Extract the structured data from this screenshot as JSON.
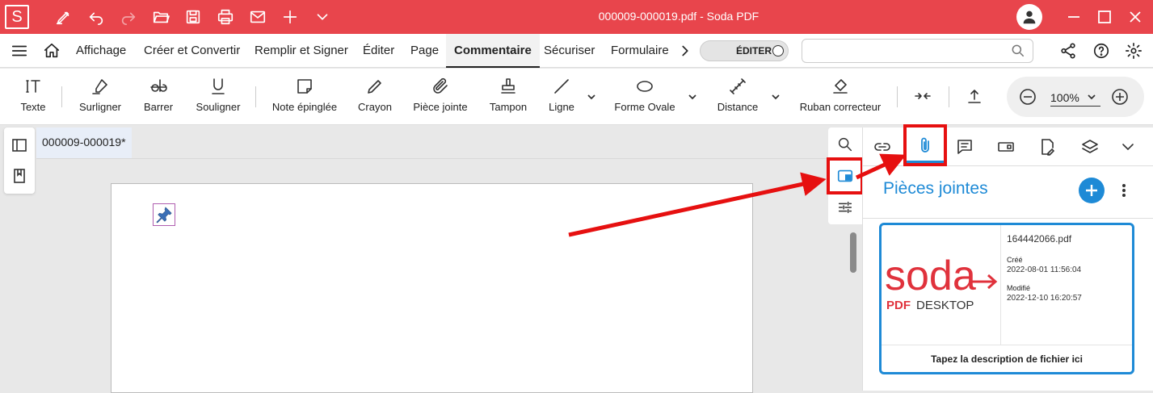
{
  "app": {
    "logo_letter": "S",
    "title": "000009-000019.pdf  -  Soda PDF"
  },
  "menu": {
    "items": [
      "Affichage",
      "Créer et Convertir",
      "Remplir et Signer",
      "Éditer",
      "Page",
      "Commentaire",
      "Sécuriser",
      "Formulaire"
    ],
    "active": "Commentaire",
    "edit_toggle_label": "ÉDITER",
    "search_placeholder": ""
  },
  "toolbar": {
    "tools": [
      {
        "label": "Texte",
        "icon": "text-icon"
      },
      {
        "label": "Surligner",
        "icon": "highlight-icon"
      },
      {
        "label": "Barrer",
        "icon": "strikethrough-icon"
      },
      {
        "label": "Souligner",
        "icon": "underline-icon"
      },
      {
        "label": "Note épinglée",
        "icon": "sticky-note-icon"
      },
      {
        "label": "Crayon",
        "icon": "pencil-icon"
      },
      {
        "label": "Pièce jointe",
        "icon": "paperclip-icon"
      },
      {
        "label": "Tampon",
        "icon": "stamp-icon"
      },
      {
        "label": "Ligne",
        "icon": "line-icon"
      },
      {
        "label": "Forme Ovale",
        "icon": "oval-icon"
      },
      {
        "label": "Distance",
        "icon": "distance-icon"
      },
      {
        "label": "Ruban correcteur",
        "icon": "eraser-icon"
      }
    ],
    "zoom": "100%"
  },
  "document": {
    "tab_name": "000009-000019*"
  },
  "right_panel": {
    "title": "Pièces jointes",
    "attachment": {
      "file_name": "164442066.pdf",
      "created_label": "Créé",
      "created_value": "2022-08-01 11:56:04",
      "modified_label": "Modifié",
      "modified_value": "2022-12-10 16:20:57",
      "thumb_brand": "soda",
      "thumb_sub_pdf": "PDF",
      "thumb_sub_desktop": "DESKTOP",
      "description_placeholder": "Tapez la description de fichier ici"
    }
  },
  "colors": {
    "titlebar": "#e8454c",
    "accent_blue": "#1e8ad6",
    "annotation_red": "#e61010",
    "brand_red": "#e0323c"
  }
}
